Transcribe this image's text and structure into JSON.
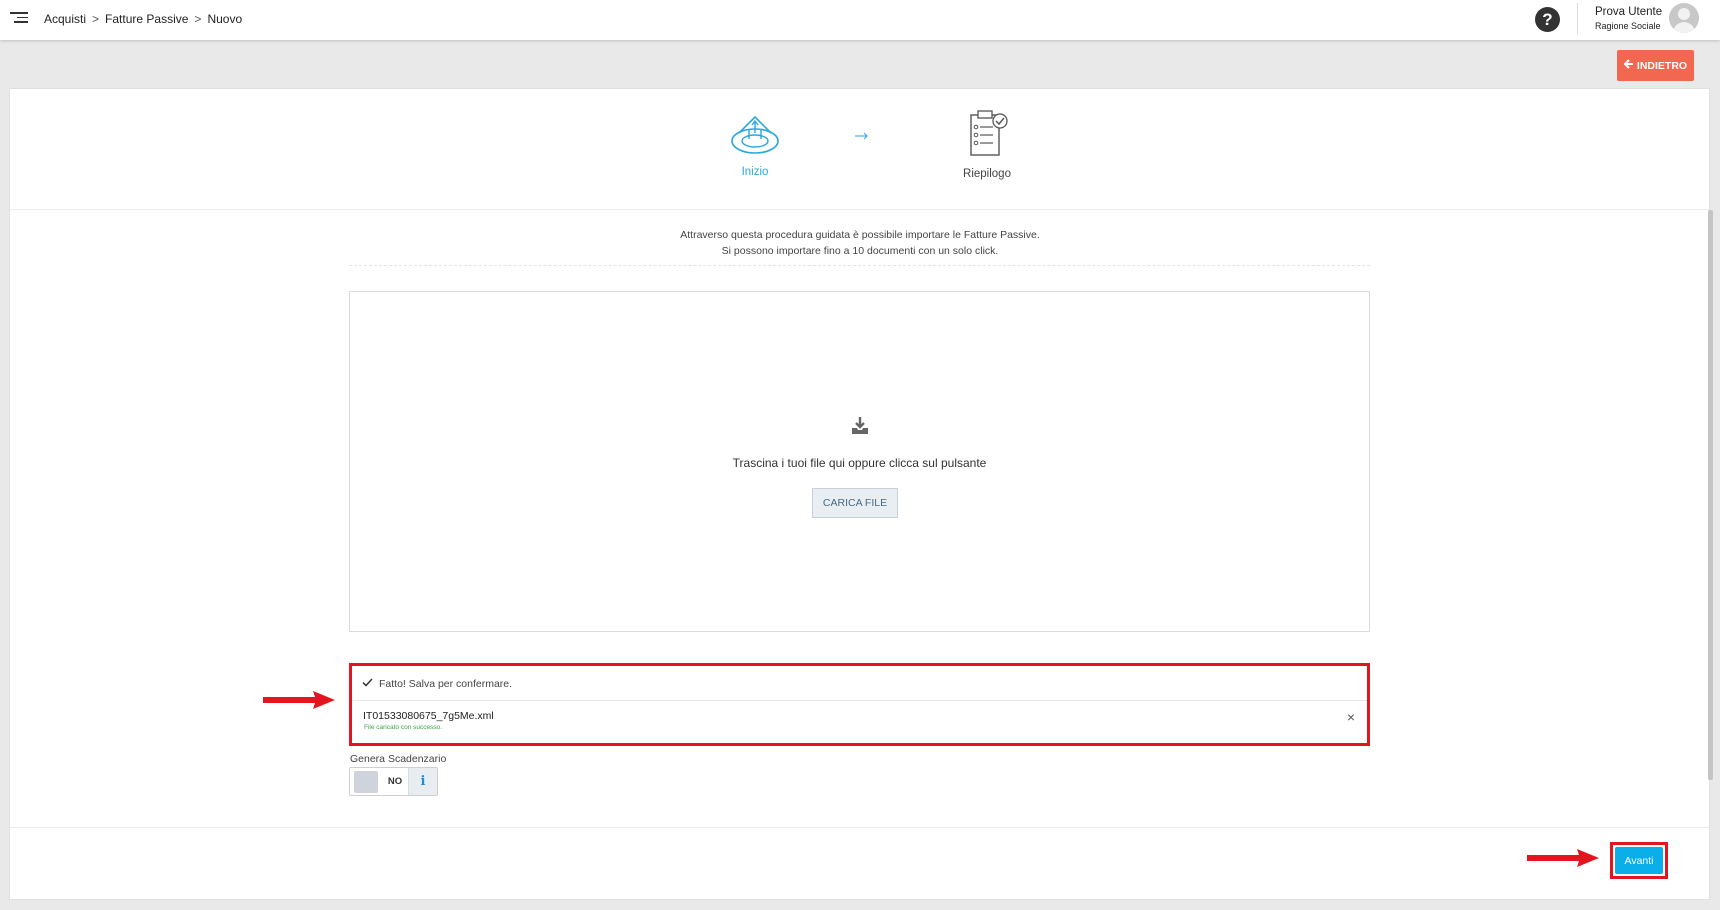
{
  "breadcrumb": {
    "items": [
      "Acquisti",
      "Fatture Passive",
      "Nuovo"
    ],
    "separator": ">"
  },
  "header": {
    "help_label": "?",
    "user_name": "Prova Utente",
    "user_company": "Ragione Sociale"
  },
  "actions": {
    "back_label": "INDIETRO"
  },
  "steps": [
    {
      "label": "Inizio",
      "active": true,
      "icon": "home-upload-icon"
    },
    {
      "label": "Riepilogo",
      "active": false,
      "icon": "checklist-icon"
    }
  ],
  "intro": {
    "line1": "Attraverso questa procedura guidata è possibile importare le Fatture Passive.",
    "line2": "Si possono importare fino a 10 documenti con un solo click."
  },
  "dropzone": {
    "text": "Trascina i tuoi file qui oppure clicca sul pulsante",
    "button_label": "CARICA FILE"
  },
  "upload_result": {
    "status": "Fatto! Salva per confermare.",
    "file_name": "IT01533080675_7g5Me.xml",
    "file_status": "File caricato con successo.",
    "remove_label": "×"
  },
  "scadenzario": {
    "label": "Genera Scadenzario",
    "value": "NO",
    "info_label": "i"
  },
  "footer": {
    "next_label": "Avanti"
  },
  "colors": {
    "accent": "#0aaee8",
    "back_button": "#f2674f",
    "highlight": "#e3161f",
    "success": "#3aa648"
  }
}
